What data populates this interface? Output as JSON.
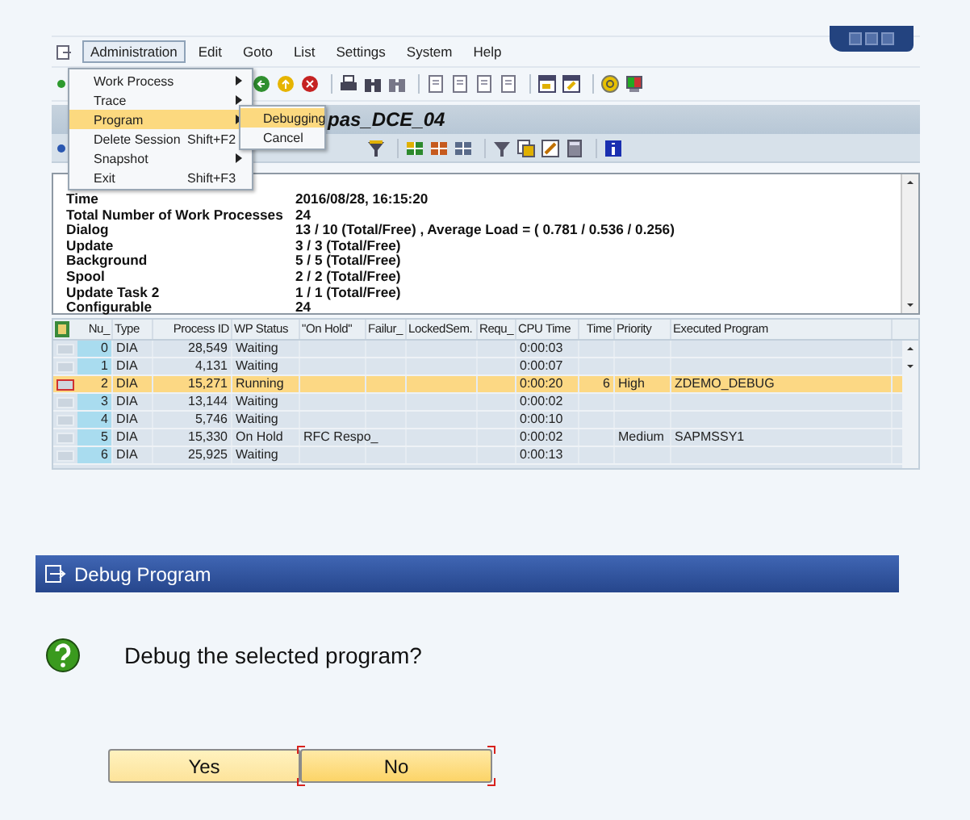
{
  "menubar": {
    "items": [
      {
        "label": "Administration",
        "selected": true
      },
      {
        "label": "Edit",
        "selected": false
      },
      {
        "label": "Goto",
        "selected": false
      },
      {
        "label": "List",
        "selected": false
      },
      {
        "label": "Settings",
        "selected": false
      },
      {
        "label": "System",
        "selected": false
      },
      {
        "label": "Help",
        "selected": false
      }
    ]
  },
  "menu": {
    "items": [
      {
        "label": "Work Process",
        "has_submenu": true,
        "selected": false
      },
      {
        "label": "Trace",
        "has_submenu": true,
        "selected": false
      },
      {
        "label": "Program",
        "has_submenu": true,
        "selected": true
      },
      {
        "label": "Delete Session",
        "shortcut": "Shift+F2",
        "has_submenu": false,
        "selected": false
      },
      {
        "label": "Snapshot",
        "has_submenu": true,
        "selected": false
      },
      {
        "label": "Exit",
        "shortcut": "Shift+F3",
        "has_submenu": false,
        "selected": false
      }
    ]
  },
  "submenu": {
    "items": [
      {
        "label": "Debugging",
        "selected": true
      },
      {
        "label": "Cancel",
        "selected": false
      }
    ]
  },
  "title": "pas_DCE_04",
  "info": [
    {
      "label": "Time",
      "value": "2016/08/28, 16:15:20"
    },
    {
      "label": "Total Number of Work Processes",
      "value": "24"
    },
    {
      "label": "Dialog",
      "value": "13 / 10 (Total/Free) , Average Load = ( 0.781 / 0.536 / 0.256)"
    },
    {
      "label": "Update",
      "value": "3 / 3 (Total/Free)"
    },
    {
      "label": "Background",
      "value": "5 / 5 (Total/Free)"
    },
    {
      "label": "Spool",
      "value": "2 / 2 (Total/Free)"
    },
    {
      "label": "Update Task 2",
      "value": "1 / 1 (Total/Free)"
    },
    {
      "label": "Configurable",
      "value": "24"
    }
  ],
  "table": {
    "columns": [
      "Nu_",
      "Type",
      "Process ID",
      "WP Status",
      "\"On Hold\"",
      "Failur_",
      "LockedSem.",
      "Requ_",
      "CPU Time",
      "Time",
      "Priority",
      "Executed Program"
    ],
    "rows": [
      {
        "selected": false,
        "cells": [
          "0",
          "DIA",
          "28,549",
          "Waiting",
          null,
          null,
          null,
          null,
          "0:00:03",
          null,
          null,
          null
        ]
      },
      {
        "selected": false,
        "cells": [
          "1",
          "DIA",
          "4,131",
          "Waiting",
          null,
          null,
          null,
          null,
          "0:00:07",
          null,
          null,
          null
        ]
      },
      {
        "selected": true,
        "cells": [
          "2",
          "DIA",
          "15,271",
          "Running",
          null,
          null,
          null,
          null,
          "0:00:20",
          "6",
          "High",
          "ZDEMO_DEBUG"
        ]
      },
      {
        "selected": false,
        "cells": [
          "3",
          "DIA",
          "13,144",
          "Waiting",
          null,
          null,
          null,
          null,
          "0:00:02",
          null,
          null,
          null
        ]
      },
      {
        "selected": false,
        "cells": [
          "4",
          "DIA",
          "5,746",
          "Waiting",
          null,
          null,
          null,
          null,
          "0:00:10",
          null,
          null,
          null
        ]
      },
      {
        "selected": false,
        "cells": [
          "5",
          "DIA",
          "15,330",
          "On Hold",
          "RFC Respo_",
          null,
          null,
          null,
          "0:00:02",
          null,
          "Medium",
          "SAPMSSY1"
        ]
      },
      {
        "selected": false,
        "cells": [
          "6",
          "DIA",
          "25,925",
          "Waiting",
          null,
          null,
          null,
          null,
          "0:00:13",
          null,
          null,
          null
        ]
      }
    ]
  },
  "dialog": {
    "title": "Debug Program",
    "message": "Debug the selected program?",
    "buttons": [
      {
        "label": "Yes",
        "focused": false
      },
      {
        "label": "No",
        "focused": true
      }
    ]
  }
}
